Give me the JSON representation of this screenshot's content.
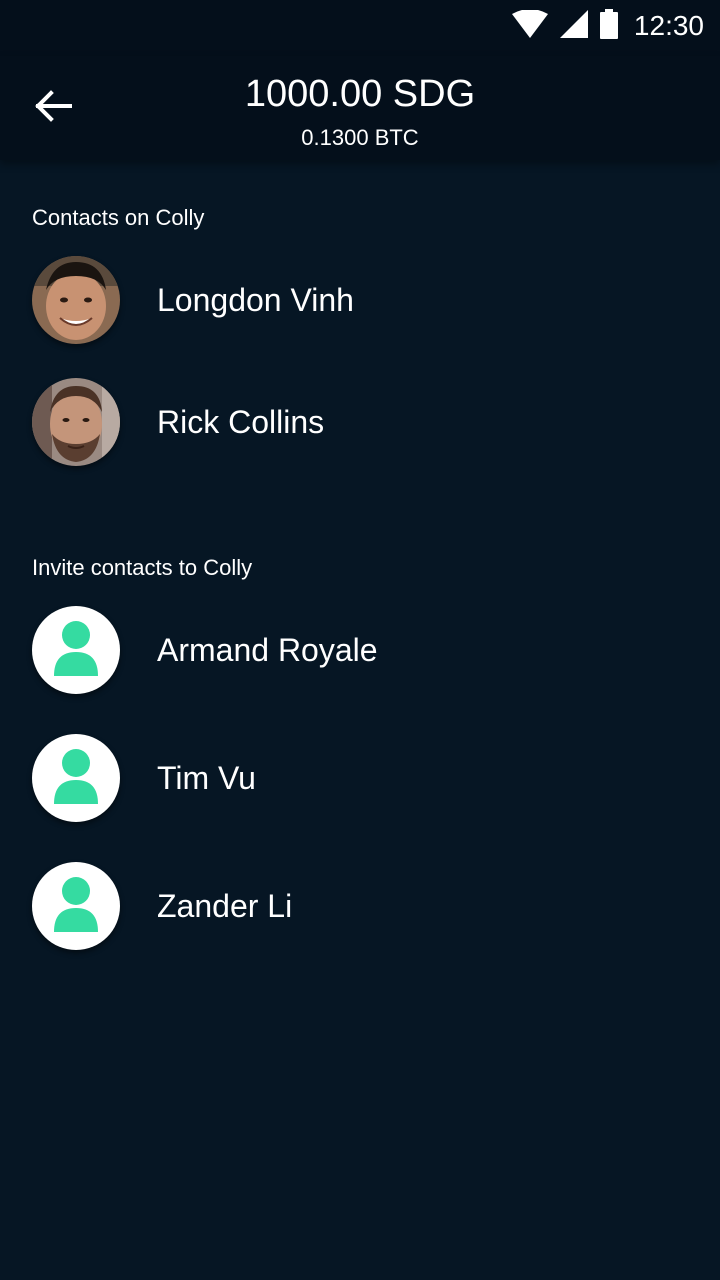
{
  "status_bar": {
    "time": "12:30",
    "icons": [
      "wifi-icon",
      "cell-signal-icon",
      "battery-icon"
    ]
  },
  "header": {
    "back_icon": "arrow-left-icon",
    "amount": "1000.00 SDG",
    "amount_btc": "0.1300 BTC"
  },
  "sections": {
    "on_colly": {
      "title": "Contacts on Colly",
      "contacts": [
        {
          "name": "Longdon Vinh",
          "avatar": "photo"
        },
        {
          "name": "Rick Collins",
          "avatar": "photo"
        }
      ]
    },
    "invite": {
      "title": "Invite contacts to Colly",
      "contacts": [
        {
          "name": "Armand Royale",
          "avatar": "person-icon"
        },
        {
          "name": "Tim Vu",
          "avatar": "person-icon"
        },
        {
          "name": "Zander Li",
          "avatar": "person-icon"
        }
      ]
    }
  },
  "colors": {
    "background": "#061624",
    "header_background": "#040f1b",
    "accent": "#35dba1",
    "text": "#ffffff"
  }
}
